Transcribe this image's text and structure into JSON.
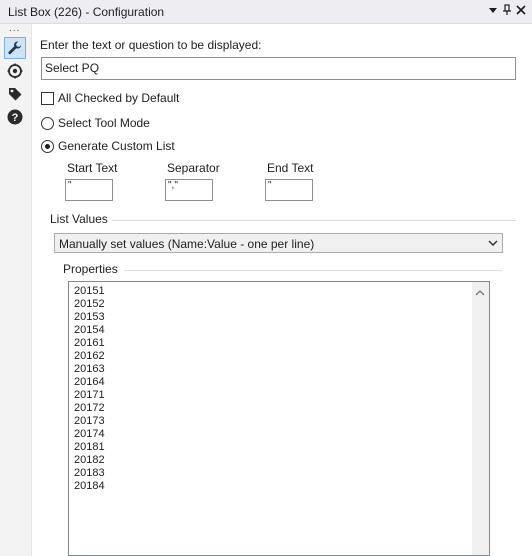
{
  "window": {
    "title": "List Box (226) - Configuration"
  },
  "sidebar": {
    "more_dots": "..."
  },
  "form": {
    "prompt_label": "Enter the text or question to be displayed:",
    "prompt_value": "Select PQ",
    "all_checked_label": "All Checked by Default",
    "select_tool_mode_label": "Select Tool Mode",
    "generate_custom_list_label": "Generate Custom List",
    "start_text_label": "Start Text",
    "start_text_value": "\"",
    "separator_label": "Separator",
    "separator_value": "\",\"",
    "end_text_label": "End Text",
    "end_text_value": "\""
  },
  "list_values": {
    "group_label": "List Values",
    "dropdown_value": "Manually set values (Name:Value - one per line)",
    "properties_label": "Properties",
    "items": [
      "20151",
      "20152",
      "20153",
      "20154",
      "20161",
      "20162",
      "20163",
      "20164",
      "20171",
      "20172",
      "20173",
      "20174",
      "20181",
      "20182",
      "20183",
      "20184"
    ]
  },
  "colors": {
    "titlebar": "#eeeef2",
    "active_tool_bg": "#cfe3f6",
    "active_tool_border": "#7fb0dd"
  }
}
